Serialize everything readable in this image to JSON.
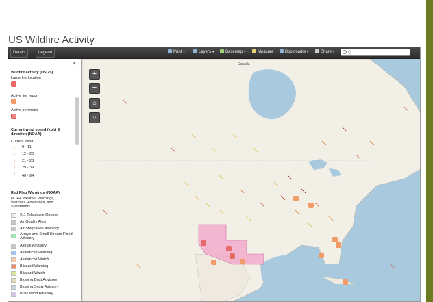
{
  "page": {
    "title": "US Wildfire Activity"
  },
  "toolbar": {
    "details": "Details",
    "legend": "Legend",
    "print": "Print",
    "layers": "Layers",
    "basemap": "Basemap",
    "measure": "Measure",
    "bookmarks": "Bookmarks",
    "share": "Share",
    "search_placeholder": "Q"
  },
  "legend": {
    "section1_title": "Wildfire activity (USGS)",
    "large_fire": "Large fire location",
    "active_fire": "Active fire report",
    "active_perimeter": "Active perimeter",
    "section2_title": "Current wind speed (kph) & direction (NOAA)",
    "current_wind": "Current Wind",
    "wind_classes": [
      "0 - 11",
      "12 - 20",
      "21 - 28",
      "29 - 39",
      "40 - 94"
    ],
    "section3_title": "Red Flag Warnings (NOAA)",
    "section3_sub": "NOAA Weather Warnings, Watches, Advisories, and Statements",
    "warnings": [
      {
        "label": "911 Telephone Outage",
        "color": "#f0f0f0"
      },
      {
        "label": "Air Quality Alert",
        "color": "#c9c9c9"
      },
      {
        "label": "Air Stagnation Advisory",
        "color": "#c9c9c9"
      },
      {
        "label": "Arroyo and Small Stream Flood Advisory",
        "color": "#9fe7b7"
      },
      {
        "label": "Ashfall Advisory",
        "color": "#c9c9c9"
      },
      {
        "label": "Avalanche Warning",
        "color": "#9fc6ef"
      },
      {
        "label": "Avalanche Watch",
        "color": "#f4c9a9"
      },
      {
        "label": "Blizzard Warning",
        "color": "#f08a6a"
      },
      {
        "label": "Blizzard Watch",
        "color": "#dfe79a"
      },
      {
        "label": "Blowing Dust Advisory",
        "color": "#e4dcb4"
      },
      {
        "label": "Blowing Snow Advisory",
        "color": "#c9d6e6"
      },
      {
        "label": "Brisk Wind Advisory",
        "color": "#d6c9e6"
      }
    ]
  },
  "map": {
    "canada_label": "Canada"
  }
}
